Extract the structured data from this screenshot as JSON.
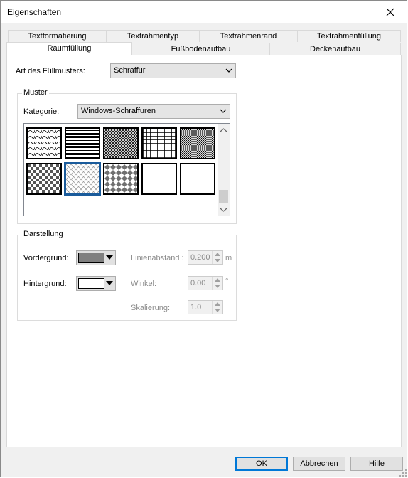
{
  "window": {
    "title": "Eigenschaften",
    "close_icon": "close-icon"
  },
  "tabs_row1": [
    "Textformatierung",
    "Textrahmentyp",
    "Textrahmenrand",
    "Textrahmenfüllung"
  ],
  "tabs_row2": [
    "Raumfüllung",
    "Fußbodenaufbau",
    "Deckenaufbau"
  ],
  "active_tab": "Raumfüllung",
  "fill": {
    "label": "Art des Füllmusters:",
    "value": "Schraffur"
  },
  "muster": {
    "group_title": "Muster",
    "category_label": "Kategorie:",
    "category_value": "Windows-Schraffuren",
    "selected_index": 6,
    "patterns": [
      "diagonal-swirl",
      "horizontal-fine",
      "cross-dense",
      "grid-square",
      "cross-fine",
      "checker",
      "diagonal-cross",
      "diamond",
      "blank",
      "blank"
    ]
  },
  "darstellung": {
    "group_title": "Darstellung",
    "foreground_label": "Vordergrund:",
    "foreground_color": "#808080",
    "background_label": "Hintergrund:",
    "background_color": "#ffffff",
    "spacing_label": "Linienabstand :",
    "spacing_value": "0.200",
    "spacing_unit": "m",
    "angle_label": "Winkel:",
    "angle_value": "0.00",
    "angle_unit": "°",
    "scale_label": "Skalierung:",
    "scale_value": "1.0"
  },
  "buttons": {
    "ok": "OK",
    "cancel": "Abbrechen",
    "help": "Hilfe"
  },
  "colors": {
    "accent": "#0078d7",
    "selection": "#1a5b9b"
  }
}
